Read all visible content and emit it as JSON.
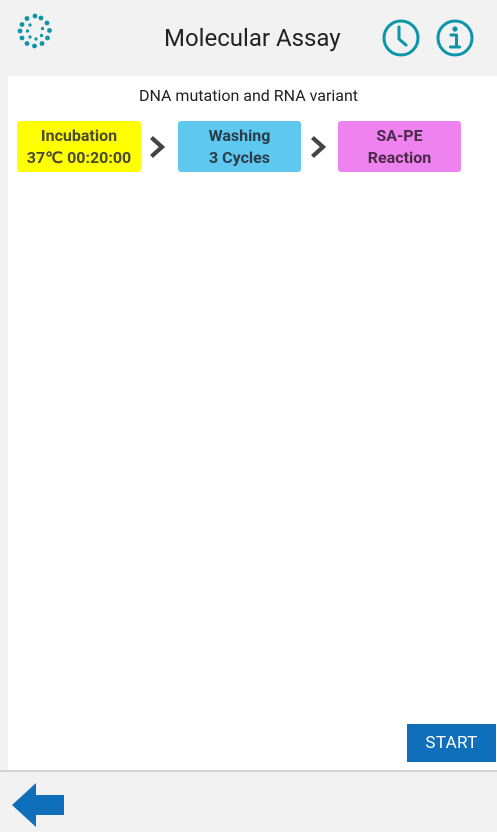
{
  "header": {
    "title": "Molecular Assay",
    "logo_icon": "dotted-circle-logo-icon",
    "history_icon": "clock-icon",
    "info_icon": "info-icon",
    "accent_color": "#0a95a8"
  },
  "workflow": {
    "name": "DNA mutation and RNA variant",
    "steps": [
      {
        "line1": "Incubation",
        "line2": "37℃ 00:20:00",
        "color": "#ffff00"
      },
      {
        "line1": "Washing",
        "line2": "3 Cycles",
        "color": "#5ec8ef"
      },
      {
        "line1": "SA-PE",
        "line2": "Reaction",
        "color": "#ee82ee"
      }
    ],
    "separator_icon": "chevron-right-icon"
  },
  "actions": {
    "start_label": "START",
    "start_color": "#0f6fbb"
  },
  "footer": {
    "back_icon": "back-arrow-icon",
    "back_color": "#0f6fbb"
  }
}
